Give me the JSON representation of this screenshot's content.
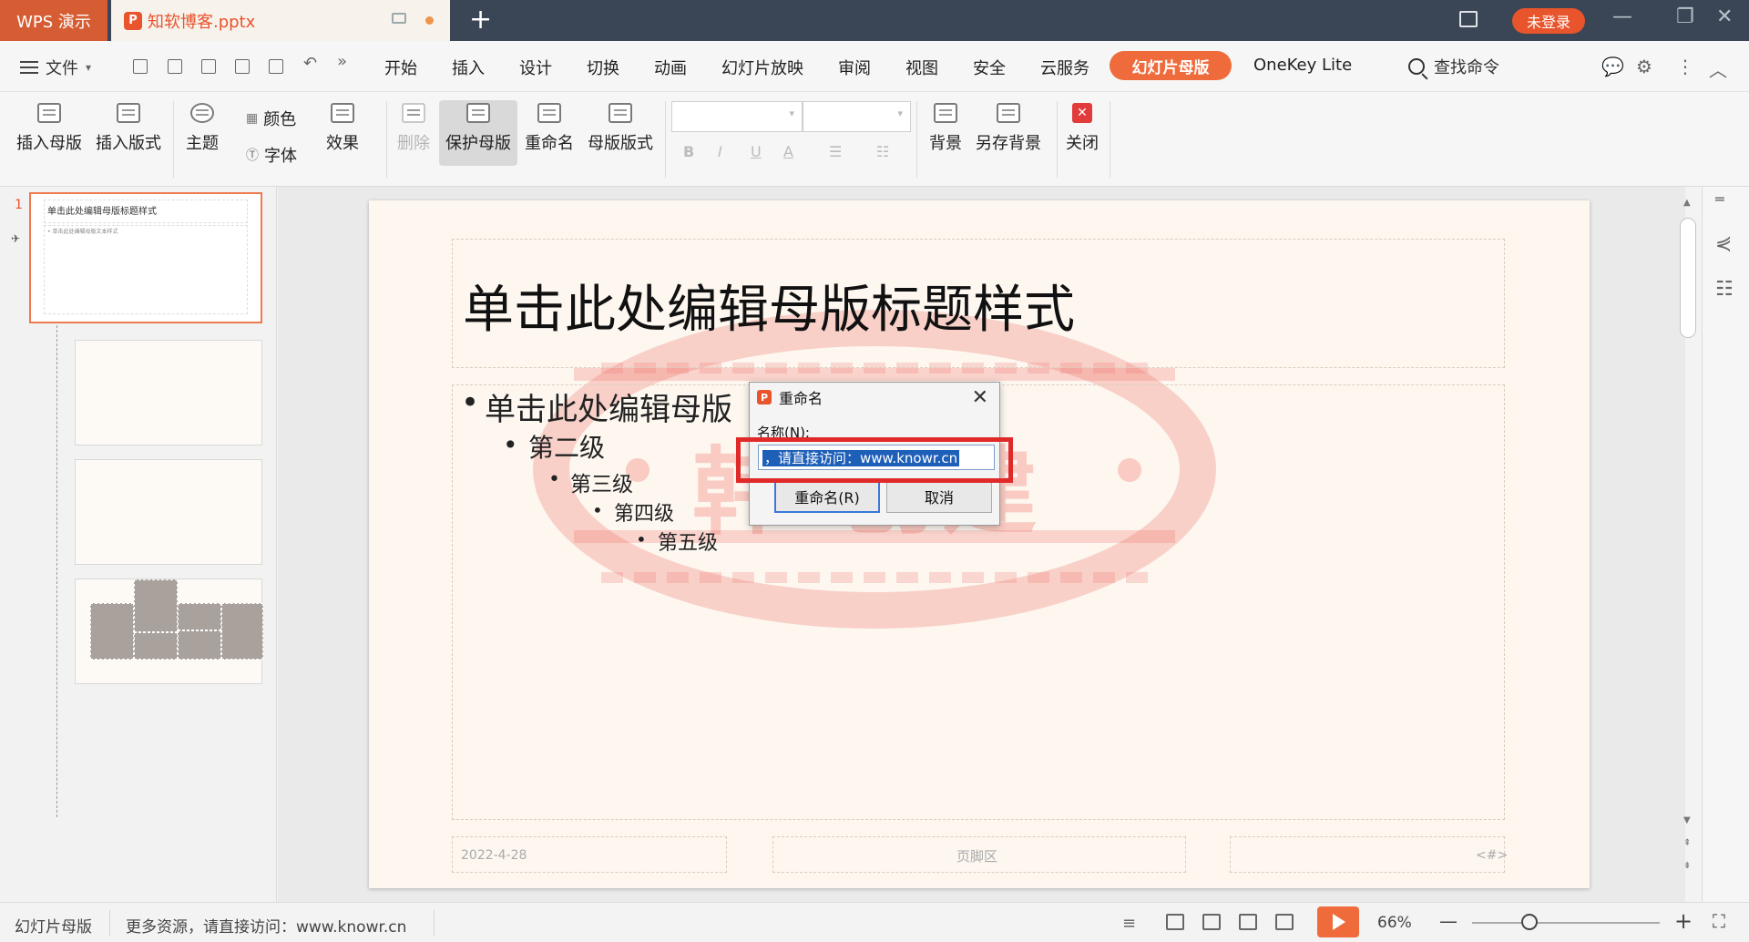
{
  "titlebar": {
    "app_name": "WPS 演示",
    "doc_name": "知软博客.pptx",
    "p_glyph": "P",
    "new_tab": "+",
    "login": "未登录",
    "controls": [
      "—",
      "❐",
      "✕"
    ]
  },
  "menubar": {
    "file": "文件",
    "items": [
      "开始",
      "插入",
      "设计",
      "切换",
      "动画",
      "幻灯片放映",
      "审阅",
      "视图",
      "安全",
      "云服务"
    ],
    "active": "幻灯片母版",
    "onekey": "OneKey Lite",
    "search": "查找命令"
  },
  "ribbon": {
    "insert_master": "插入母版",
    "insert_layout": "插入版式",
    "theme": "主题",
    "color": "颜色",
    "font": "字体",
    "effect": "效果",
    "delete": "删除",
    "protect_master": "保护母版",
    "rename": "重命名",
    "master_layout": "母版版式",
    "background": "背景",
    "save_background": "另存背景",
    "close": "关闭",
    "close_glyph": "✕",
    "fmt": [
      "B",
      "I",
      "U",
      "A"
    ]
  },
  "thumbs": {
    "number": "1",
    "master_title": "单击此处编辑母版标题样式",
    "master_body": "• 单击此处编辑母版文本样式",
    "pin": "✈"
  },
  "slide": {
    "title": "单击此处编辑母版标题样式",
    "level1": "单击此处编辑母版",
    "level2": "第二级",
    "level3": "第三级",
    "level4": "第四级",
    "level5": "第五级",
    "bullet": "•",
    "footer_date": "2022-4-28",
    "footer_center": "页脚区",
    "footer_num": "<#>",
    "watermark": "韩 创建"
  },
  "dialog": {
    "title": "重命名",
    "p_glyph": "P",
    "close": "✕",
    "label": "名称(N):",
    "value": "，请直接访问：www.knowr.cn",
    "ok": "重命名(R)",
    "cancel": "取消"
  },
  "statusbar": {
    "mode": "幻灯片母版",
    "info": "更多资源，请直接访问：www.knowr.cn",
    "zoom": "66%",
    "minus": "—",
    "plus": "+"
  },
  "colors": {
    "accent": "#ef6b3c",
    "titlebar": "#3a4655",
    "highlight_box": "#e02a2a",
    "selection": "#1e5fb8"
  }
}
